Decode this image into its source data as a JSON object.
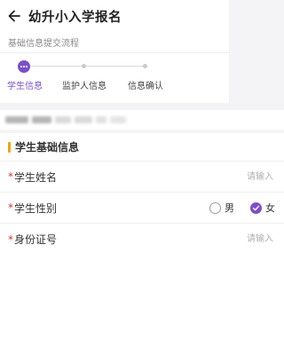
{
  "header": {
    "title": "幼升小入学报名",
    "back_icon": "arrow-left-icon"
  },
  "subtitle": "基础信息提交流程",
  "steps": [
    {
      "label": "学生信息",
      "active": true
    },
    {
      "label": "监护人信息",
      "active": false
    },
    {
      "label": "信息确认",
      "active": false
    }
  ],
  "section": {
    "title": "学生基础信息"
  },
  "fields": {
    "name": {
      "required_mark": "*",
      "label": "学生姓名",
      "placeholder": "请输入"
    },
    "gender": {
      "required_mark": "*",
      "label": "学生性别",
      "options": [
        {
          "label": "男",
          "checked": false
        },
        {
          "label": "女",
          "checked": true
        }
      ]
    },
    "id_number": {
      "required_mark": "*",
      "label": "身份证号",
      "placeholder": "请输入"
    }
  },
  "colors": {
    "accent": "#7a4fcf",
    "section_bar": "#f0a400",
    "required": "#e0352b"
  }
}
